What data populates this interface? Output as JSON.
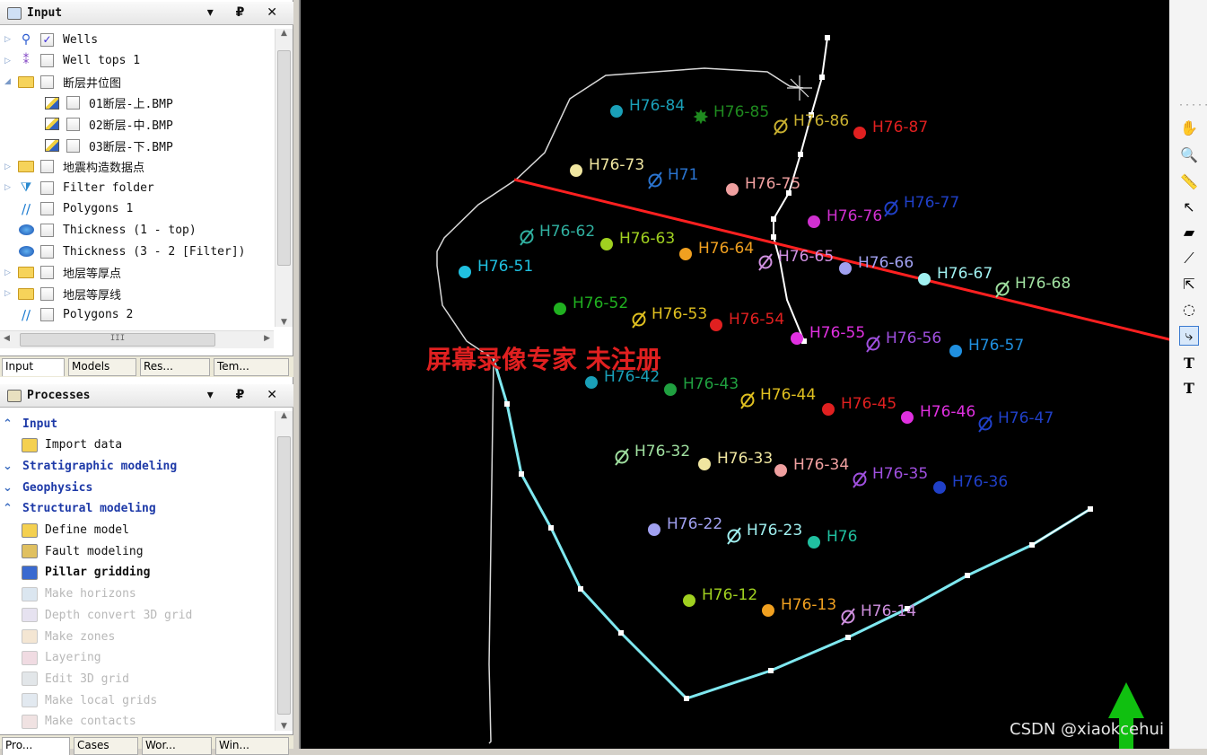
{
  "input_panel": {
    "title": "Input",
    "controls": "▾ ₽ ✕",
    "items": [
      {
        "label": "Wells",
        "checked": true,
        "icon": "wells-icon"
      },
      {
        "label": "Well tops 1",
        "checked": false,
        "icon": "well-tops-icon"
      },
      {
        "label": "断层井位图",
        "checked": false,
        "icon": "folder-icon"
      },
      {
        "label": "01断层-上.BMP",
        "checked": false,
        "icon": "bitmap-icon"
      },
      {
        "label": "02断层-中.BMP",
        "checked": false,
        "icon": "bitmap-icon"
      },
      {
        "label": "03断层-下.BMP",
        "checked": false,
        "icon": "bitmap-icon"
      },
      {
        "label": "地震构造数据点",
        "checked": false,
        "icon": "folder-icon"
      },
      {
        "label": "Filter folder",
        "checked": false,
        "icon": "filter-folder-icon"
      },
      {
        "label": "Polygons 1",
        "checked": false,
        "icon": "polygons-icon"
      },
      {
        "label": "Thickness (1 - top)",
        "checked": false,
        "icon": "surface-icon"
      },
      {
        "label": "Thickness (3 - 2 [Filter])",
        "checked": false,
        "icon": "surface-icon"
      },
      {
        "label": "地层等厚点",
        "checked": false,
        "icon": "folder-icon"
      },
      {
        "label": "地层等厚线",
        "checked": false,
        "icon": "folder-icon"
      },
      {
        "label": "Polygons 2",
        "checked": false,
        "icon": "polygons-icon"
      }
    ],
    "tabs": [
      "Input",
      "Models",
      "Res...",
      "Tem..."
    ],
    "hscroll_grip": "III"
  },
  "processes_panel": {
    "title": "Processes",
    "controls": "▾ ₽ ✕",
    "items": [
      {
        "label": "Input",
        "kind": "head",
        "chev": "⌃"
      },
      {
        "label": "Import data",
        "kind": "item"
      },
      {
        "label": "Stratigraphic modeling",
        "kind": "head",
        "chev": "⌄"
      },
      {
        "label": "Geophysics",
        "kind": "head",
        "chev": "⌄"
      },
      {
        "label": "Structural modeling",
        "kind": "head",
        "chev": "⌃"
      },
      {
        "label": "Define model",
        "kind": "item"
      },
      {
        "label": "Fault modeling",
        "kind": "item"
      },
      {
        "label": "Pillar gridding",
        "kind": "bold"
      },
      {
        "label": "Make horizons",
        "kind": "disabled"
      },
      {
        "label": "Depth convert 3D grid",
        "kind": "disabled"
      },
      {
        "label": "Make zones",
        "kind": "disabled"
      },
      {
        "label": "Layering",
        "kind": "disabled"
      },
      {
        "label": "Edit 3D grid",
        "kind": "disabled"
      },
      {
        "label": "Make local grids",
        "kind": "disabled"
      },
      {
        "label": "Make contacts",
        "kind": "disabled"
      }
    ],
    "tabs": [
      "Pro...",
      "Cases",
      "Wor...",
      "Win..."
    ]
  },
  "map": {
    "watermark": "屏幕录像专家 未注册",
    "credit": "CSDN @xiaokcehui",
    "wells": [
      {
        "name": "H76-84",
        "color": "#1aa0b8",
        "sym": "dot"
      },
      {
        "name": "H76-85",
        "color": "#1f8a1f",
        "sym": "star"
      },
      {
        "name": "H76-86",
        "color": "#c8b030",
        "sym": "ring"
      },
      {
        "name": "H76-87",
        "color": "#e02020",
        "sym": "dot"
      },
      {
        "name": "H76-73",
        "color": "#f0e6a0",
        "sym": "dot"
      },
      {
        "name": "H71",
        "color": "#2a74d0",
        "sym": "ring"
      },
      {
        "name": "H76-75",
        "color": "#f0a0a0",
        "sym": "dot"
      },
      {
        "name": "H76-76",
        "color": "#d030d0",
        "sym": "dot"
      },
      {
        "name": "H76-77",
        "color": "#2040c8",
        "sym": "ring"
      },
      {
        "name": "H76-62",
        "color": "#30b0a0",
        "sym": "ring"
      },
      {
        "name": "H76-63",
        "color": "#a0d020",
        "sym": "dot"
      },
      {
        "name": "H76-64",
        "color": "#f0a020",
        "sym": "dot"
      },
      {
        "name": "H76-65",
        "color": "#d090e0",
        "sym": "ring"
      },
      {
        "name": "H76-66",
        "color": "#a0a0f0",
        "sym": "dot"
      },
      {
        "name": "H76-67",
        "color": "#a0f0f0",
        "sym": "dot"
      },
      {
        "name": "H76-68",
        "color": "#a0e0a0",
        "sym": "ring"
      },
      {
        "name": "H76-51",
        "color": "#20c0e0",
        "sym": "dot"
      },
      {
        "name": "H76-52",
        "color": "#20b020",
        "sym": "dot"
      },
      {
        "name": "H76-53",
        "color": "#e0c020",
        "sym": "ring"
      },
      {
        "name": "H76-54",
        "color": "#e02020",
        "sym": "dot"
      },
      {
        "name": "H76-55",
        "color": "#e030e0",
        "sym": "dot"
      },
      {
        "name": "H76-56",
        "color": "#a050e0",
        "sym": "ring"
      },
      {
        "name": "H76-57",
        "color": "#2090e0",
        "sym": "dot"
      },
      {
        "name": "H76-42",
        "color": "#1aa0b8",
        "sym": "dot"
      },
      {
        "name": "H76-43",
        "color": "#20a040",
        "sym": "dot"
      },
      {
        "name": "H76-44",
        "color": "#e0c020",
        "sym": "ring"
      },
      {
        "name": "H76-45",
        "color": "#e02020",
        "sym": "dot"
      },
      {
        "name": "H76-46",
        "color": "#e030e0",
        "sym": "dot"
      },
      {
        "name": "H76-47",
        "color": "#2040c8",
        "sym": "ring"
      },
      {
        "name": "H76-32",
        "color": "#a0e0a0",
        "sym": "ring"
      },
      {
        "name": "H76-33",
        "color": "#f0e6a0",
        "sym": "dot"
      },
      {
        "name": "H76-34",
        "color": "#f0a0a0",
        "sym": "dot"
      },
      {
        "name": "H76-35",
        "color": "#a050e0",
        "sym": "ring"
      },
      {
        "name": "H76-36",
        "color": "#2040c8",
        "sym": "dot"
      },
      {
        "name": "H76-22",
        "color": "#a0a0f0",
        "sym": "dot"
      },
      {
        "name": "H76-23",
        "color": "#a0f0f0",
        "sym": "ring"
      },
      {
        "name": "H76",
        "color": "#20c0a0",
        "sym": "dot"
      },
      {
        "name": "H76-12",
        "color": "#a0d020",
        "sym": "dot"
      },
      {
        "name": "H76-13",
        "color": "#f0a020",
        "sym": "dot"
      },
      {
        "name": "H76-14",
        "color": "#d090e0",
        "sym": "ring"
      }
    ]
  },
  "toolbar": {
    "buttons": [
      {
        "name": "pan-hand-icon",
        "glyph": "✋"
      },
      {
        "name": "zoom-icon",
        "glyph": "🔍"
      },
      {
        "name": "measure-icon",
        "glyph": "📏"
      },
      {
        "name": "select-arrow-icon",
        "glyph": "↖"
      },
      {
        "name": "layer-icon",
        "glyph": "▰"
      },
      {
        "name": "pick-icon",
        "glyph": "⟋"
      },
      {
        "name": "select-edit-icon",
        "glyph": "⇱"
      },
      {
        "name": "polygon-icon",
        "glyph": "◌"
      },
      {
        "name": "fault-trace-icon",
        "glyph": "⤷"
      },
      {
        "name": "text-add-icon",
        "glyph": "T"
      },
      {
        "name": "text-edit-icon",
        "glyph": "T"
      }
    ],
    "grip": "·····"
  }
}
